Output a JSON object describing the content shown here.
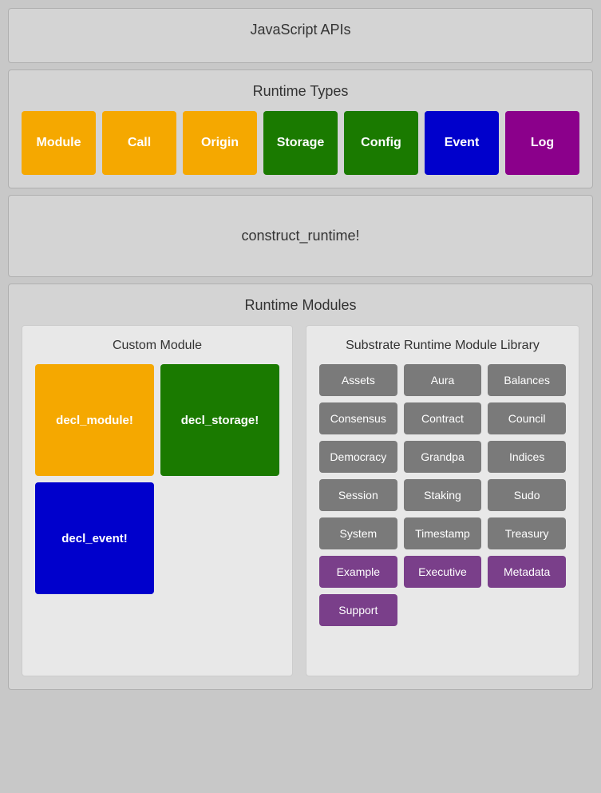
{
  "sections": {
    "javascript_apis": {
      "title": "JavaScript APIs"
    },
    "runtime_types": {
      "title": "Runtime Types",
      "tiles": [
        {
          "label": "Module",
          "color": "#f5a800"
        },
        {
          "label": "Call",
          "color": "#f5a800"
        },
        {
          "label": "Origin",
          "color": "#f5a800"
        },
        {
          "label": "Storage",
          "color": "#1a7a00"
        },
        {
          "label": "Config",
          "color": "#1a7a00"
        },
        {
          "label": "Event",
          "color": "#0000cc"
        },
        {
          "label": "Log",
          "color": "#8b008b"
        }
      ]
    },
    "construct_runtime": {
      "text": "construct_runtime!"
    },
    "runtime_modules": {
      "title": "Runtime Modules",
      "custom_module": {
        "title": "Custom Module",
        "tiles": [
          {
            "label": "decl_module!",
            "class": "decl-module-tile"
          },
          {
            "label": "decl_storage!",
            "class": "decl-storage-tile"
          },
          {
            "label": "decl_event!",
            "class": "decl-event-tile"
          }
        ]
      },
      "substrate_library": {
        "title": "Substrate Runtime Module Library",
        "gray_tiles": [
          "Assets",
          "Aura",
          "Balances",
          "Consensus",
          "Contract",
          "Council",
          "Democracy",
          "Grandpa",
          "Indices",
          "Session",
          "Staking",
          "Sudo",
          "System",
          "Timestamp",
          "Treasury"
        ],
        "purple_tiles": [
          "Example",
          "Executive",
          "Metadata",
          "Support"
        ]
      }
    }
  }
}
